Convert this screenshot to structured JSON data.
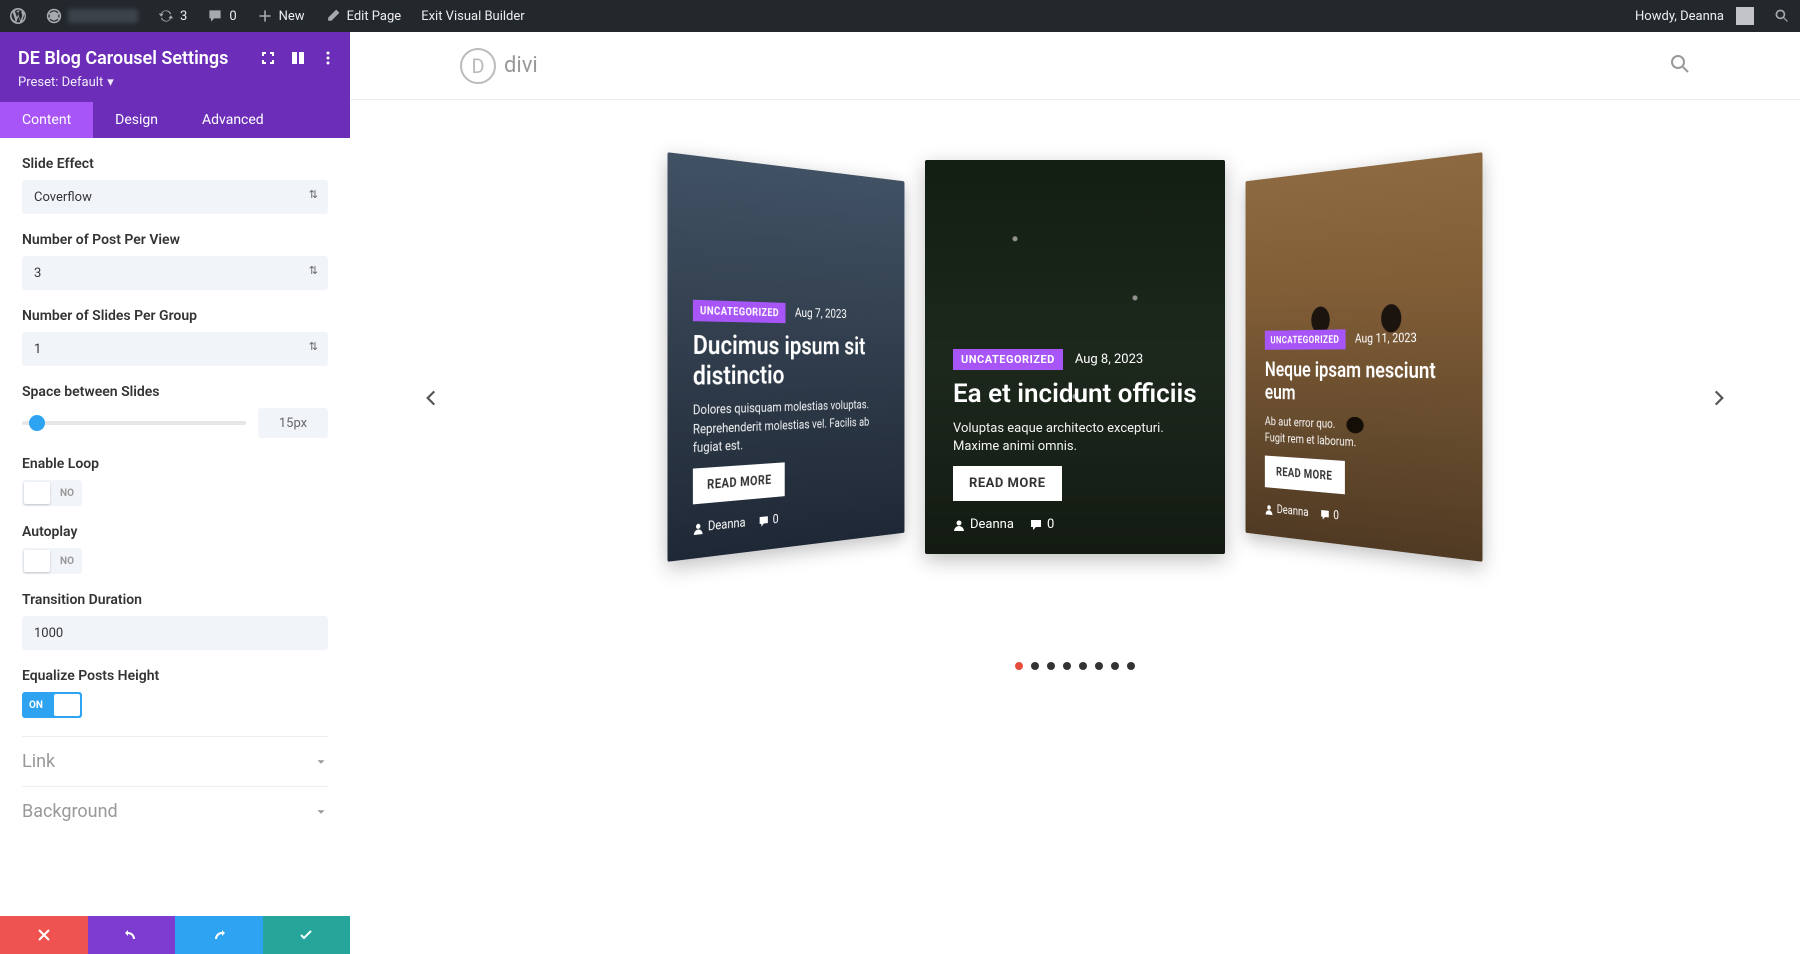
{
  "adminbar": {
    "refresh_count": "3",
    "comments_count": "0",
    "new_label": "New",
    "edit_label": "Edit Page",
    "exit_label": "Exit Visual Builder",
    "howdy": "Howdy, Deanna"
  },
  "panel": {
    "title": "DE Blog Carousel Settings",
    "preset": "Preset: Default",
    "tabs": {
      "content": "Content",
      "design": "Design",
      "advanced": "Advanced"
    },
    "fields": {
      "slide_effect": {
        "label": "Slide Effect",
        "value": "Coverflow"
      },
      "posts_per_view": {
        "label": "Number of Post Per View",
        "value": "3"
      },
      "slides_per_group": {
        "label": "Number of Slides Per Group",
        "value": "1"
      },
      "space_between": {
        "label": "Space between Slides",
        "value": "15px"
      },
      "enable_loop": {
        "label": "Enable Loop",
        "value": "NO"
      },
      "autoplay": {
        "label": "Autoplay",
        "value": "NO"
      },
      "transition_duration": {
        "label": "Transition Duration",
        "value": "1000"
      },
      "equalize_height": {
        "label": "Equalize Posts Height",
        "value": "ON"
      }
    },
    "accordions": {
      "link": "Link",
      "background": "Background"
    }
  },
  "site": {
    "logo_text": "divi"
  },
  "carousel": {
    "badge": "UNCATEGORIZED",
    "read_more": "READ MORE",
    "cards": [
      {
        "date": "Aug 7, 2023",
        "title": "Ducimus ipsum sit distinctio",
        "desc": "Dolores quisquam molestias voluptas. Reprehenderit molestias vel. Facilis ab fugiat est.",
        "author": "Deanna",
        "comments": "0"
      },
      {
        "date": "Aug 8, 2023",
        "title": "Ea et incidunt officiis",
        "desc": "Voluptas eaque architecto excepturi. Maxime animi omnis.",
        "author": "Deanna",
        "comments": "0"
      },
      {
        "date": "Aug 11, 2023",
        "title": "Neque ipsam nesciunt eum",
        "desc": "Ab aut error quo.\nFugit rem et laborum.",
        "author": "Deanna",
        "comments": "0"
      }
    ],
    "dot_count": 8
  }
}
